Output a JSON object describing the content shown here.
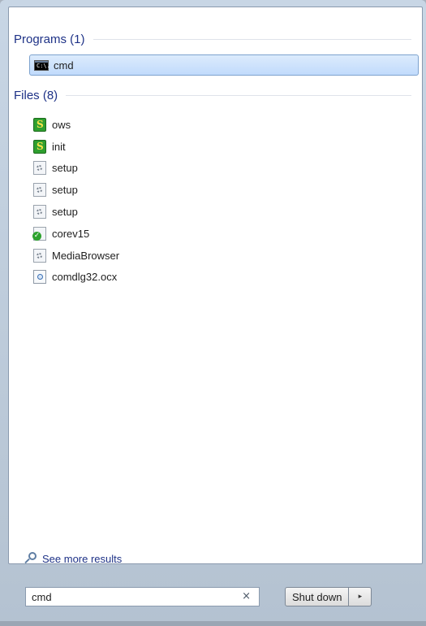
{
  "programs": {
    "header": "Programs (1)",
    "items": [
      {
        "label": "cmd",
        "icon": "cmd-icon"
      }
    ]
  },
  "files": {
    "header": "Files (8)",
    "items": [
      {
        "label": "ows",
        "icon": "script-file-icon"
      },
      {
        "label": "init",
        "icon": "script-file-icon"
      },
      {
        "label": "setup",
        "icon": "settings-file-icon"
      },
      {
        "label": "setup",
        "icon": "settings-file-icon"
      },
      {
        "label": "setup",
        "icon": "settings-file-icon"
      },
      {
        "label": "corev15",
        "icon": "verified-file-icon"
      },
      {
        "label": "MediaBrowser",
        "icon": "settings-file-icon"
      },
      {
        "label": "comdlg32.ocx",
        "icon": "activex-file-icon"
      }
    ]
  },
  "see_more": {
    "label": "See more results",
    "icon": "search-icon"
  },
  "search": {
    "value": "cmd",
    "clear_label": "×"
  },
  "shutdown": {
    "label": "Shut down",
    "arrow": "▸"
  },
  "icons": {
    "cmd": "C:\\."
  }
}
